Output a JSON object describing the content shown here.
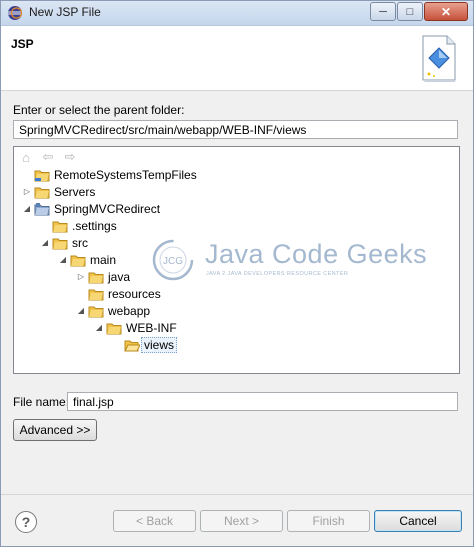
{
  "window": {
    "title": "New JSP File"
  },
  "titlebar_buttons": {
    "minimize": "─",
    "maximize": "□",
    "close": "✕"
  },
  "banner": {
    "title": "JSP"
  },
  "folder": {
    "label": "Enter or select the parent folder:",
    "value": "SpringMVCRedirect/src/main/webapp/WEB-INF/views"
  },
  "tree": {
    "toolbar": {
      "home": "⌂",
      "back": "⇦",
      "forward": "⇨"
    },
    "items": [
      {
        "label": "RemoteSystemsTempFiles",
        "twisty": "",
        "icon": "folder-icon"
      },
      {
        "label": "Servers",
        "twisty": "▷",
        "icon": "folder-icon"
      },
      {
        "label": "SpringMVCRedirect",
        "twisty": "◢",
        "icon": "project-icon"
      },
      {
        "label": ".settings",
        "twisty": "",
        "icon": "folder-icon"
      },
      {
        "label": "src",
        "twisty": "◢",
        "icon": "folder-icon"
      },
      {
        "label": "main",
        "twisty": "◢",
        "icon": "folder-icon"
      },
      {
        "label": "java",
        "twisty": "▷",
        "icon": "folder-icon"
      },
      {
        "label": "resources",
        "twisty": "",
        "icon": "folder-icon"
      },
      {
        "label": "webapp",
        "twisty": "◢",
        "icon": "folder-icon"
      },
      {
        "label": "WEB-INF",
        "twisty": "◢",
        "icon": "folder-icon"
      },
      {
        "label": "views",
        "twisty": "",
        "icon": "folder-open-icon",
        "selected": true
      }
    ]
  },
  "watermark": {
    "logo": "JCG",
    "text": "Java Code Geeks",
    "subtitle": "JAVA 2 JAVA DEVELOPERS RESOURCE CENTER"
  },
  "filename": {
    "label": "File name:",
    "value": "final.jsp"
  },
  "buttons": {
    "advanced": "Advanced >>",
    "back": "< Back",
    "next": "Next >",
    "finish": "Finish",
    "cancel": "Cancel",
    "help": "?"
  }
}
